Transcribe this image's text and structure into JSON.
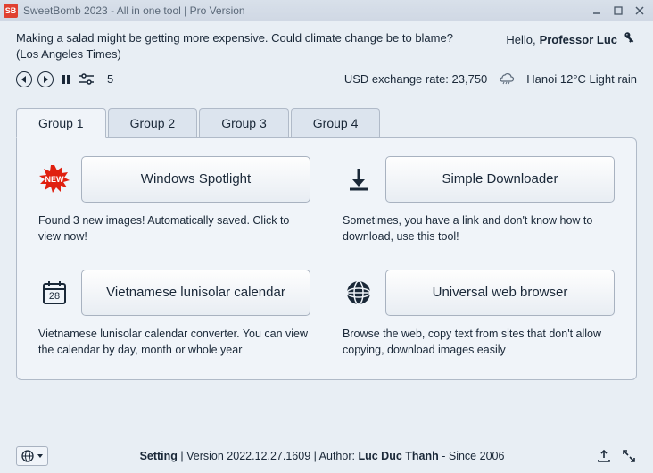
{
  "titlebar": {
    "icon_text": "SB",
    "title": "SweetBomb 2023 - All in one tool | Pro Version"
  },
  "headline": "Making a salad might be getting more expensive. Could climate change be to blame? (Los Angeles Times)",
  "greeting": {
    "hello": "Hello,",
    "name": "Professor Luc"
  },
  "controls": {
    "count": "5"
  },
  "status": {
    "exchange": "USD exchange rate: 23,750",
    "weather": "Hanoi 12°C Light rain"
  },
  "tabs": [
    "Group 1",
    "Group 2",
    "Group 3",
    "Group 4"
  ],
  "tools": [
    {
      "label": "Windows Spotlight",
      "desc": "Found 3 new images! Automatically saved. Click to view now!"
    },
    {
      "label": "Simple Downloader",
      "desc": "Sometimes, you have a link and don't know how to download, use this tool!"
    },
    {
      "label": "Vietnamese lunisolar calendar",
      "desc": "Vietnamese lunisolar calendar converter. You can view the calendar by day, month or whole year"
    },
    {
      "label": "Universal web browser",
      "desc": "Browse the web, copy text from sites that don't allow copying, download images easily"
    }
  ],
  "calendar_day": "28",
  "footer": {
    "setting": "Setting",
    "version": "Version 2022.12.27.1609",
    "author_label": "Author:",
    "author": "Luc Duc Thanh",
    "since": "- Since 2006"
  }
}
